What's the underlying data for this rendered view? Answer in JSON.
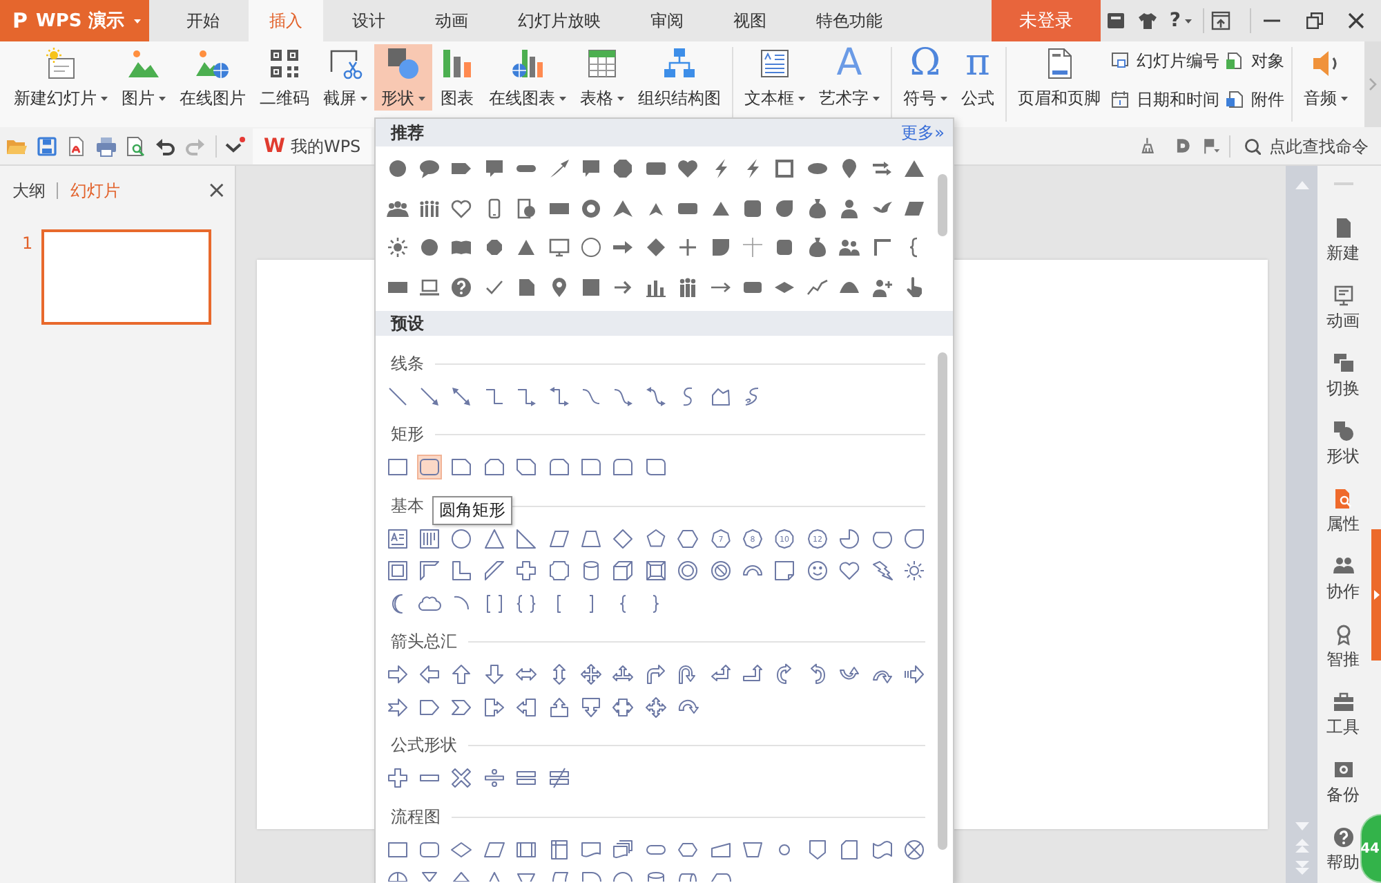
{
  "app_menu": {
    "logo": "P",
    "label": "WPS 演示"
  },
  "tabs": [
    {
      "label": "开始",
      "selected": false
    },
    {
      "label": "插入",
      "selected": true
    },
    {
      "label": "设计",
      "selected": false
    },
    {
      "label": "动画",
      "selected": false
    },
    {
      "label": "幻灯片放映",
      "selected": false
    },
    {
      "label": "审阅",
      "selected": false
    },
    {
      "label": "视图",
      "selected": false
    },
    {
      "label": "特色功能",
      "selected": false
    }
  ],
  "account": {
    "label": "未登录"
  },
  "help": {
    "label": "?"
  },
  "ribbon": {
    "groups": [
      {
        "buttons": [
          {
            "kind": "large",
            "label": "新建幻灯片",
            "dropdown": true,
            "active": false
          },
          {
            "kind": "large",
            "label": "图片",
            "dropdown": true,
            "active": false
          },
          {
            "kind": "large",
            "label": "在线图片",
            "dropdown": false,
            "active": false
          },
          {
            "kind": "large",
            "label": "二维码",
            "dropdown": false,
            "active": false
          },
          {
            "kind": "large",
            "label": "截屏",
            "dropdown": true,
            "active": false
          },
          {
            "kind": "large",
            "label": "形状",
            "dropdown": true,
            "active": true
          },
          {
            "kind": "large",
            "label": "图表",
            "dropdown": false,
            "active": false
          },
          {
            "kind": "large",
            "label": "在线图表",
            "dropdown": true,
            "active": false
          },
          {
            "kind": "large",
            "label": "表格",
            "dropdown": true,
            "active": false
          },
          {
            "kind": "large",
            "label": "组织结构图",
            "dropdown": false,
            "active": false
          }
        ]
      },
      {
        "buttons": [
          {
            "kind": "large",
            "label": "文本框",
            "dropdown": true,
            "active": false
          },
          {
            "kind": "large",
            "glyph": "A",
            "label": "艺术字",
            "dropdown": true,
            "active": false
          }
        ]
      },
      {
        "buttons": [
          {
            "kind": "large",
            "glyph": "Ω",
            "label": "符号",
            "dropdown": true,
            "active": false
          },
          {
            "kind": "large",
            "glyph": "π",
            "label": "公式",
            "dropdown": false,
            "active": false
          }
        ]
      },
      {
        "buttons": [
          {
            "kind": "large",
            "label": "页眉和页脚",
            "dropdown": false,
            "active": false
          },
          {
            "kind": "grid",
            "items": [
              {
                "label": "幻灯片编号",
                "dropdown": false,
                "active": false
              },
              {
                "label": "对象",
                "dropdown": false,
                "active": false
              },
              {
                "label": "日期和时间",
                "dropdown": false,
                "active": false
              },
              {
                "label": "附件",
                "dropdown": false,
                "active": false
              }
            ]
          }
        ]
      },
      {
        "buttons": [
          {
            "kind": "large",
            "label": "音频",
            "dropdown": true,
            "active": false
          }
        ]
      }
    ]
  },
  "quick_access": {
    "tools": [
      {
        "disabled": false
      },
      {
        "disabled": false
      },
      {
        "disabled": false
      },
      {
        "disabled": false
      },
      {
        "disabled": false
      },
      {
        "disabled": false
      },
      {
        "disabled": true
      }
    ],
    "tab": {
      "logo": "W",
      "label": "我的WPS"
    }
  },
  "search": {
    "placeholder": "点此查找命令"
  },
  "shapes_panel": {
    "recommended": {
      "title": "推荐",
      "more": "更多»"
    },
    "presets": {
      "title": "预设",
      "sections": [
        {
          "title": "线条",
          "kind": "lines",
          "shapes": [
            {
              "hovered": false
            },
            {
              "hovered": false
            },
            {
              "hovered": false
            },
            {
              "hovered": false
            },
            {
              "hovered": false
            },
            {
              "hovered": false
            },
            {
              "hovered": false
            },
            {
              "hovered": false
            },
            {
              "hovered": false
            },
            {
              "hovered": false
            },
            {
              "hovered": false
            },
            {
              "hovered": false
            }
          ]
        },
        {
          "title": "矩形",
          "kind": "rectangles",
          "shapes": [
            {
              "hovered": false
            },
            {
              "hovered": true
            },
            {
              "hovered": false
            },
            {
              "hovered": false
            },
            {
              "hovered": false
            },
            {
              "hovered": false
            },
            {
              "hovered": false
            },
            {
              "hovered": false
            },
            {
              "hovered": false
            }
          ]
        },
        {
          "title": "基本",
          "kind": "basic",
          "shapes": [
            {
              "hovered": false
            },
            {
              "hovered": false
            },
            {
              "hovered": false
            },
            {
              "hovered": false
            },
            {
              "hovered": false
            },
            {
              "hovered": false
            },
            {
              "hovered": false
            },
            {
              "hovered": false
            },
            {
              "hovered": false
            },
            {
              "hovered": false
            },
            {
              "hovered": false,
              "label": "7"
            },
            {
              "hovered": false,
              "label": "8"
            },
            {
              "hovered": false,
              "label": "10"
            },
            {
              "hovered": false,
              "label": "12"
            },
            {
              "hovered": false
            },
            {
              "hovered": false
            },
            {
              "hovered": false
            },
            {
              "hovered": false
            },
            {
              "hovered": false
            },
            {
              "hovered": false
            },
            {
              "hovered": false
            },
            {
              "hovered": false
            },
            {
              "hovered": false
            },
            {
              "hovered": false
            },
            {
              "hovered": false
            },
            {
              "hovered": false
            },
            {
              "hovered": false
            },
            {
              "hovered": false
            },
            {
              "hovered": false
            },
            {
              "hovered": false
            },
            {
              "hovered": false
            },
            {
              "hovered": false
            },
            {
              "hovered": false
            },
            {
              "hovered": false
            },
            {
              "hovered": false
            },
            {
              "hovered": false
            },
            {
              "hovered": false
            },
            {
              "hovered": false
            },
            {
              "hovered": false
            },
            {
              "hovered": false
            },
            {
              "hovered": false
            },
            {
              "hovered": false
            },
            {
              "hovered": false
            }
          ]
        },
        {
          "title": "箭头总汇",
          "kind": "arrows",
          "shapes": [
            {
              "hovered": false
            },
            {
              "hovered": false
            },
            {
              "hovered": false
            },
            {
              "hovered": false
            },
            {
              "hovered": false
            },
            {
              "hovered": false
            },
            {
              "hovered": false
            },
            {
              "hovered": false
            },
            {
              "hovered": false
            },
            {
              "hovered": false
            },
            {
              "hovered": false
            },
            {
              "hovered": false
            },
            {
              "hovered": false
            },
            {
              "hovered": false
            },
            {
              "hovered": false
            },
            {
              "hovered": false
            },
            {
              "hovered": false
            },
            {
              "hovered": false
            },
            {
              "hovered": false
            },
            {
              "hovered": false
            },
            {
              "hovered": false
            },
            {
              "hovered": false
            },
            {
              "hovered": false
            },
            {
              "hovered": false
            },
            {
              "hovered": false
            },
            {
              "hovered": false
            },
            {
              "hovered": false
            }
          ]
        },
        {
          "title": "公式形状",
          "kind": "equation",
          "shapes": [
            {
              "hovered": false
            },
            {
              "hovered": false
            },
            {
              "hovered": false
            },
            {
              "hovered": false
            },
            {
              "hovered": false
            },
            {
              "hovered": false
            }
          ]
        },
        {
          "title": "流程图",
          "kind": "flowchart",
          "shapes": [
            {
              "hovered": false
            },
            {
              "hovered": false
            },
            {
              "hovered": false
            },
            {
              "hovered": false
            },
            {
              "hovered": false
            },
            {
              "hovered": false
            },
            {
              "hovered": false
            },
            {
              "hovered": false
            },
            {
              "hovered": false
            },
            {
              "hovered": false
            },
            {
              "hovered": false
            },
            {
              "hovered": false
            },
            {
              "hovered": false
            },
            {
              "hovered": false
            },
            {
              "hovered": false
            },
            {
              "hovered": false
            },
            {
              "hovered": false
            },
            {
              "hovered": false
            },
            {
              "hovered": false
            },
            {
              "hovered": false
            },
            {
              "hovered": false
            },
            {
              "hovered": false
            },
            {
              "hovered": false
            },
            {
              "hovered": false
            },
            {
              "hovered": false
            },
            {
              "hovered": false
            },
            {
              "hovered": false
            },
            {
              "hovered": false
            }
          ]
        }
      ]
    },
    "tooltip": "圆角矩形"
  },
  "left_panel": {
    "tabs": [
      {
        "label": "大纲",
        "selected": false
      },
      {
        "label": "幻灯片",
        "selected": true
      }
    ],
    "close": "×",
    "slides": [
      {
        "number": "1",
        "selected": true
      }
    ]
  },
  "sidebar": {
    "items": [
      {
        "label": "新建",
        "highlighted": false
      },
      {
        "label": "动画",
        "highlighted": false
      },
      {
        "label": "切换",
        "highlighted": false
      },
      {
        "label": "形状",
        "highlighted": false
      },
      {
        "label": "属性",
        "highlighted": true
      },
      {
        "label": "协作",
        "highlighted": false
      },
      {
        "label": "智推",
        "highlighted": false
      },
      {
        "label": "工具",
        "highlighted": false
      },
      {
        "label": "备份",
        "highlighted": false
      },
      {
        "label": "帮助",
        "highlighted": false
      }
    ]
  },
  "floating_ball": {
    "label": "44"
  }
}
